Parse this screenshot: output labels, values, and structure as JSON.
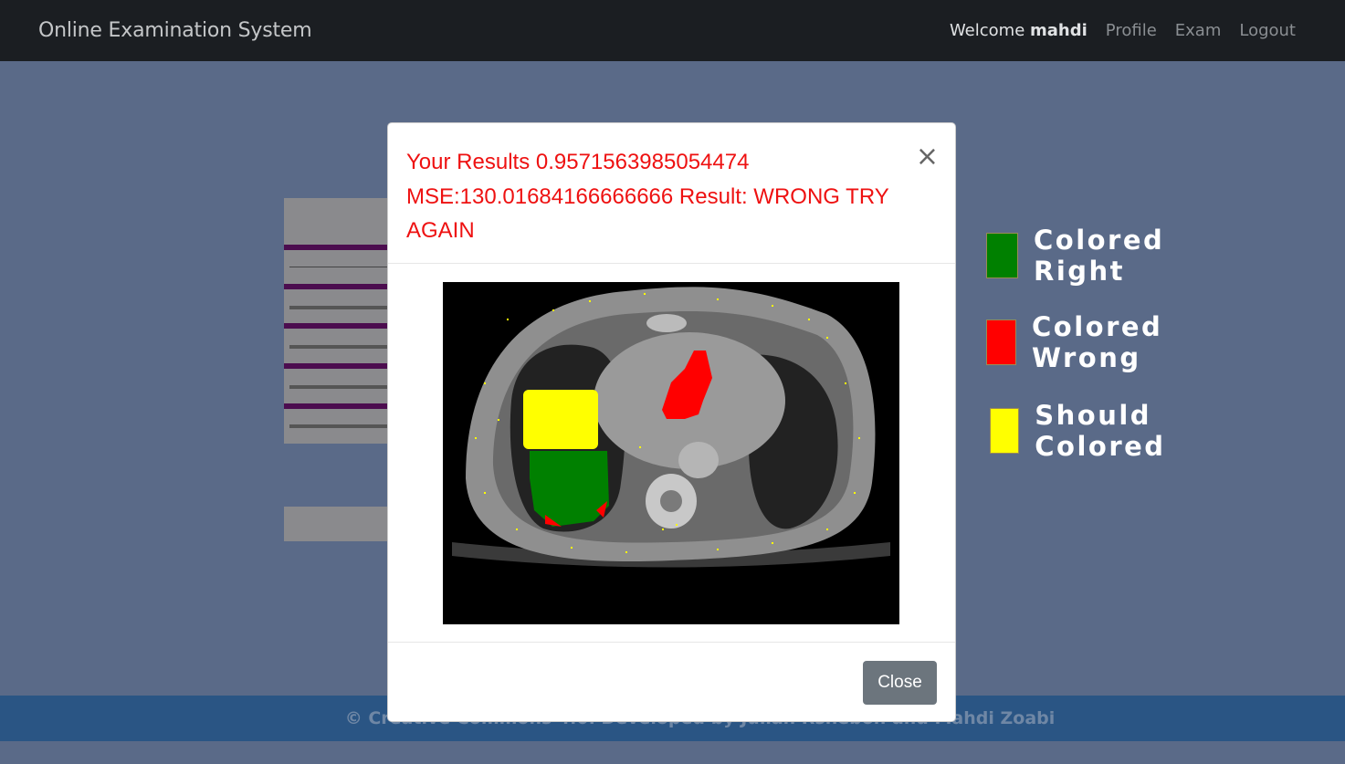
{
  "navbar": {
    "brand": "Online Examination System",
    "welcome_prefix": "Welcome",
    "username": "mahdi",
    "links": [
      "Profile",
      "Exam",
      "Logout"
    ]
  },
  "legend": [
    {
      "label": "Colored Right",
      "color": "#008000"
    },
    {
      "label": "Colored Wrong",
      "color": "#ff0000"
    },
    {
      "label": "Should Colored",
      "color": "#ffff00"
    }
  ],
  "footer": {
    "text": "© Creative Commons 4.0. Developed by Julian Rshebon and Mahdi Zoabi"
  },
  "modal": {
    "title": "Your Results 0.9571563985054474 MSE:130.01684166666666 Result: WRONG TRY AGAIN",
    "close_symbol": "×",
    "close_button": "Close"
  },
  "colors": {
    "title_red": "#ee1111",
    "right": "#008000",
    "wrong": "#ff0000",
    "should": "#ffff00"
  }
}
